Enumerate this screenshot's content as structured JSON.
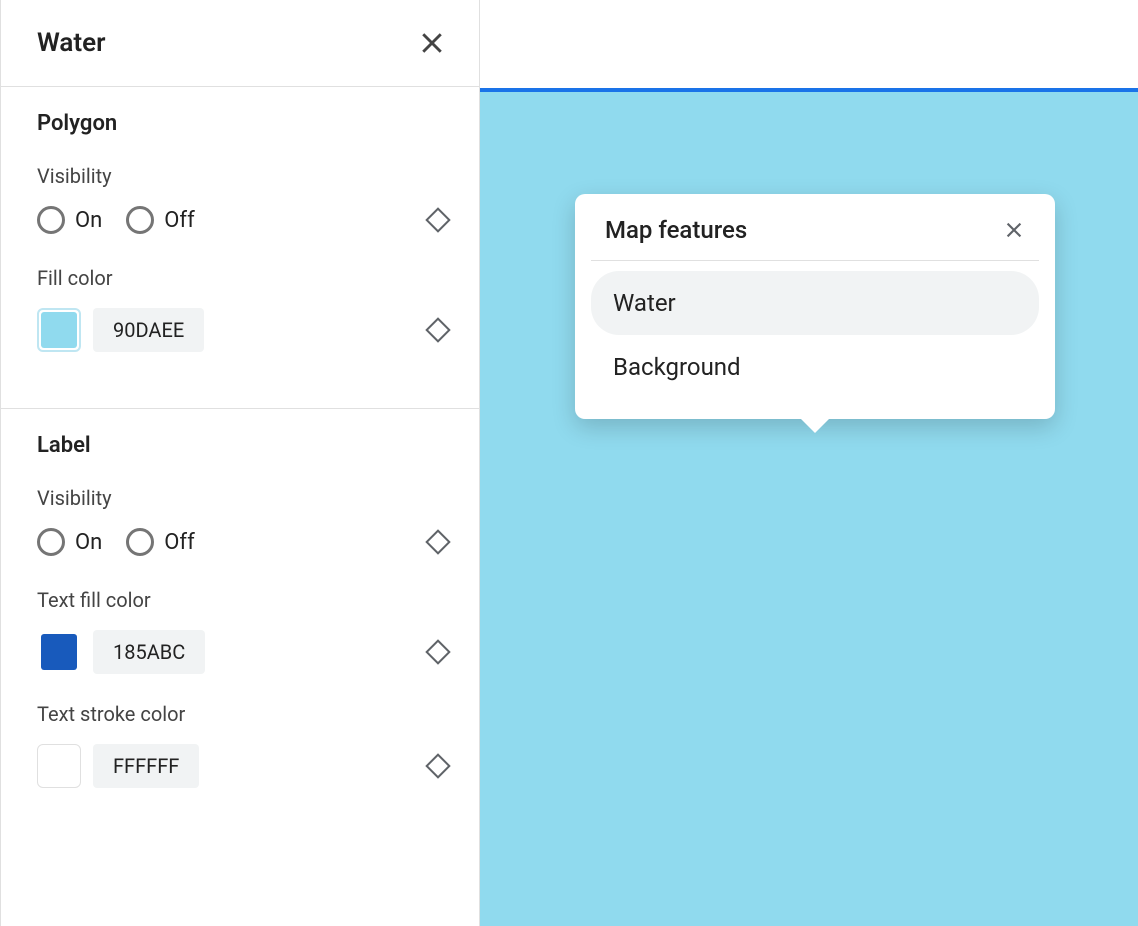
{
  "sidebar": {
    "title": "Water",
    "sections": {
      "polygon": {
        "heading": "Polygon",
        "visibility_label": "Visibility",
        "option_on": "On",
        "option_off": "Off",
        "fill_color_label": "Fill color",
        "fill_color_hex": "90DAEE",
        "fill_color_value": "#90daee"
      },
      "label": {
        "heading": "Label",
        "visibility_label": "Visibility",
        "option_on": "On",
        "option_off": "Off",
        "text_fill_label": "Text fill color",
        "text_fill_hex": "185ABC",
        "text_fill_value": "#185abc",
        "text_stroke_label": "Text stroke color",
        "text_stroke_hex": "FFFFFF",
        "text_stroke_value": "#ffffff"
      }
    }
  },
  "popup": {
    "title": "Map features",
    "items": [
      {
        "label": "Water",
        "active": true
      },
      {
        "label": "Background",
        "active": false
      }
    ]
  },
  "colors": {
    "canvas": "#90daee",
    "accent": "#1a73e8"
  }
}
